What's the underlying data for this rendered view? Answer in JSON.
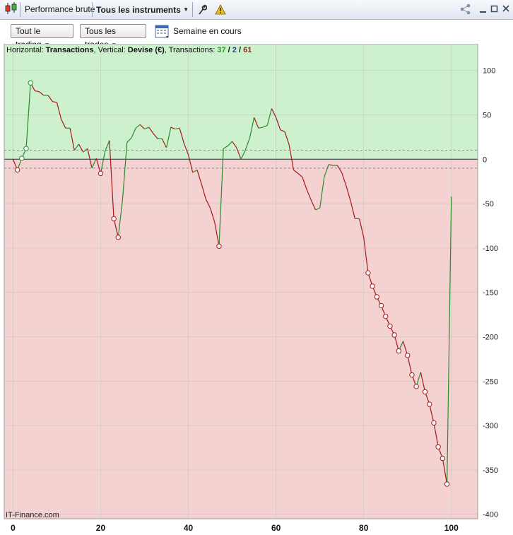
{
  "titlebar": {
    "performance_label": "Performance brute",
    "instruments_label": "Tous les instruments"
  },
  "toolbar": {
    "trading_dropdown": "Tout le trading",
    "trades_dropdown": "Tous les trades",
    "period_label": "Semaine en cours"
  },
  "legend": {
    "horizontal_prefix": "Horizontal: ",
    "horizontal_value": "Transactions",
    "vertical_prefix": ", Vertical: ",
    "vertical_value": "Devise (€)",
    "transactions_prefix": ", Transactions: ",
    "winners": "37",
    "slash1": " / ",
    "breakeven": "2",
    "slash2": " / ",
    "losers": "61"
  },
  "watermark": "IT-Finance.com",
  "colors": {
    "positive_zone": "#cdf0cd",
    "negative_zone": "#f5d2d2",
    "up_line": "#2c8a2c",
    "down_line": "#a81818",
    "winners_text": "#2b9a2b",
    "breakeven_text": "#1d3f9a",
    "losers_text": "#b01a1a"
  },
  "chart_data": {
    "type": "line",
    "xlim": [
      -2,
      106
    ],
    "ylim": [
      -405,
      130
    ],
    "x_ticks": [
      0,
      20,
      40,
      60,
      80,
      100
    ],
    "y_ticks": [
      100,
      50,
      0,
      -50,
      -100,
      -150,
      -200,
      -250,
      -300,
      -350,
      -400
    ],
    "threshold_upper": 10,
    "threshold_lower": -10,
    "grid": true,
    "series": [
      {
        "x": [
          0,
          1,
          2,
          3,
          4,
          5,
          6,
          7,
          8,
          9,
          10,
          11,
          12,
          13,
          14,
          15,
          16,
          17,
          18,
          19,
          20,
          21,
          22,
          23,
          24,
          25,
          26,
          27,
          28,
          29,
          30,
          31,
          32,
          33,
          34,
          35,
          36,
          37,
          38,
          39,
          40,
          41,
          42,
          43,
          44,
          45,
          46,
          47,
          48,
          49,
          50,
          51,
          52,
          53,
          54,
          55,
          56,
          57,
          58,
          59,
          60,
          61,
          62,
          63,
          64,
          65,
          66,
          67,
          68,
          69,
          70,
          71,
          72,
          73,
          74,
          75,
          76,
          77,
          78,
          79,
          80,
          81,
          82,
          83,
          84,
          85,
          86,
          87,
          88,
          89,
          90,
          91,
          92,
          93,
          94,
          95,
          96,
          97,
          98,
          99,
          100
        ],
        "y": [
          0,
          -12,
          1,
          12,
          86,
          77,
          76,
          72,
          72,
          65,
          64,
          45,
          35,
          35,
          10,
          17,
          8,
          12,
          -10,
          1,
          -16,
          9,
          21,
          -67,
          -88,
          -45,
          19,
          24,
          35,
          39,
          34,
          36,
          29,
          23,
          23,
          13,
          36,
          34,
          35,
          18,
          5,
          -15,
          -12,
          -28,
          -45,
          -55,
          -71,
          -98,
          12,
          15,
          20,
          13,
          0,
          10,
          24,
          47,
          35,
          36,
          38,
          57,
          47,
          33,
          31,
          16,
          -12,
          -16,
          -20,
          -34,
          -46,
          -57,
          -55,
          -20,
          -6,
          -7,
          -7,
          -15,
          -30,
          -47,
          -67,
          -67,
          -88,
          -128,
          -143,
          -155,
          -165,
          -177,
          -188,
          -198,
          -216,
          -205,
          -221,
          -243,
          -256,
          -240,
          -262,
          -276,
          -297,
          -324,
          -337,
          -366,
          -42
        ],
        "markers_at": [
          1,
          2,
          3,
          4,
          20,
          23,
          24,
          47,
          81,
          82,
          83,
          84,
          85,
          86,
          87,
          88,
          90,
          91,
          92,
          94,
          95,
          96,
          97,
          98,
          99
        ]
      }
    ]
  }
}
